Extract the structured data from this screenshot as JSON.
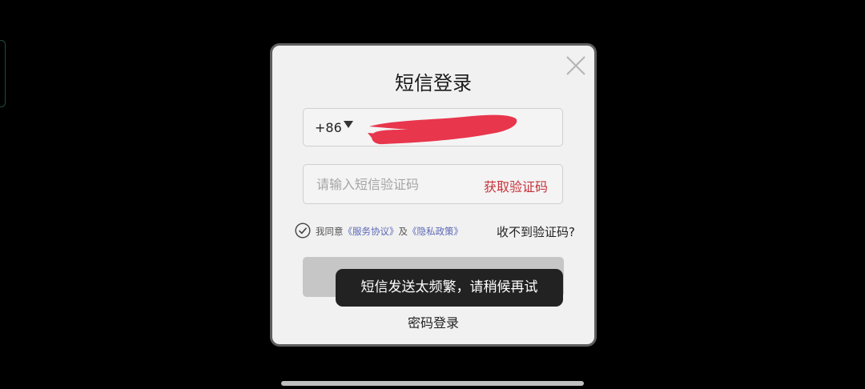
{
  "dialog": {
    "title": "短信登录",
    "close_icon": "close-icon"
  },
  "phone": {
    "country_code": "+86",
    "dropdown_icon": "caret-down-icon",
    "redacted": true
  },
  "code": {
    "placeholder": "请输入短信验证码",
    "value": "",
    "get_code_label": "获取验证码"
  },
  "agreement": {
    "checked": true,
    "prefix": "我同意",
    "terms_label": "《服务协议》",
    "conjunction": "及",
    "privacy_label": "《隐私政策》",
    "no_code_label": "收不到验证码?"
  },
  "login_button": {
    "label": ""
  },
  "password_login_label": "密码登录",
  "toast": {
    "text": "短信发送太频繁，请稍候再试"
  },
  "colors": {
    "accent_red": "#c8323a",
    "link_blue": "#5b68b5",
    "redaction": "#e8364d"
  }
}
